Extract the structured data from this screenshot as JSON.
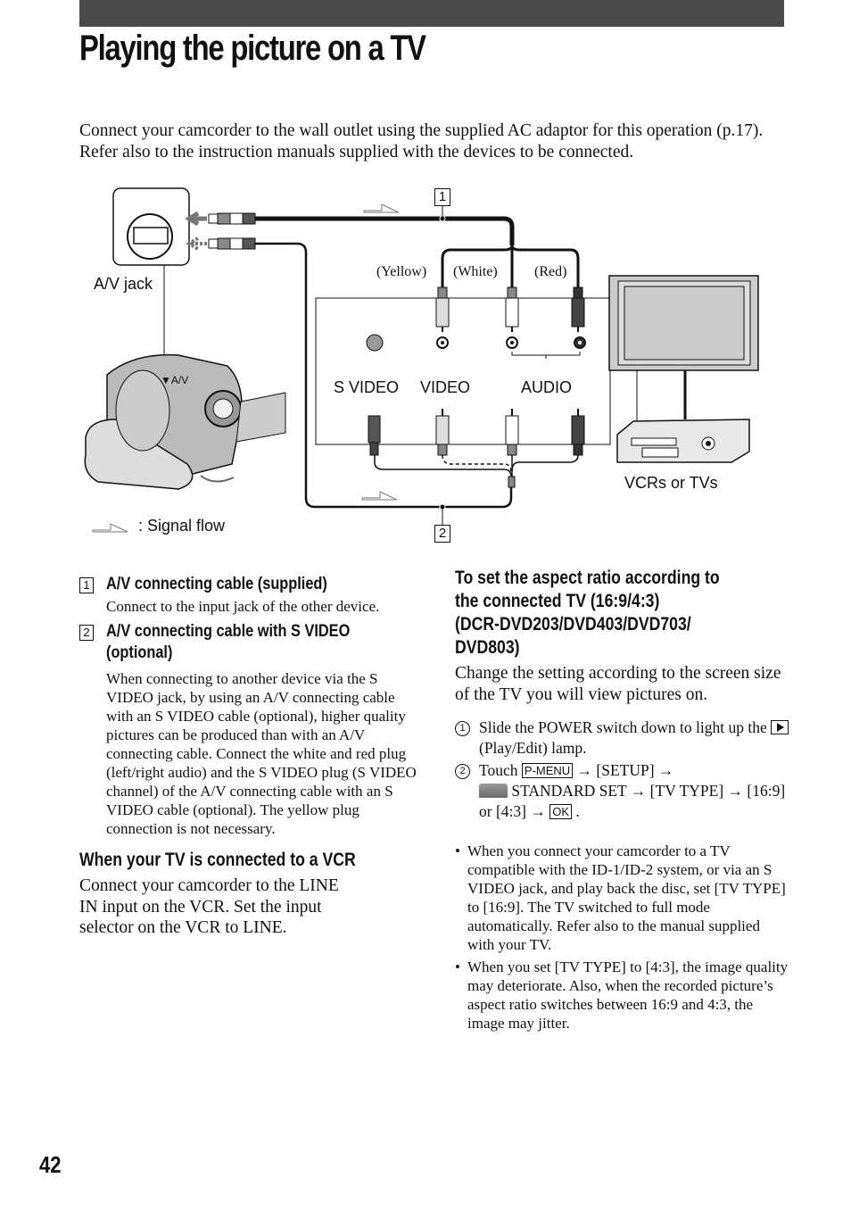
{
  "header": {
    "title": "Playing the picture on a TV",
    "intro": "Connect your camcorder to the wall outlet using the supplied AC adaptor for this operation (p.17). Refer also to the instruction manuals supplied with the devices to be connected."
  },
  "diagram": {
    "av_label": "▼A/V",
    "av_jack": "A/V jack",
    "yellow": "(Yellow)",
    "white": "(White)",
    "red": "(Red)",
    "s_video": "S VIDEO",
    "video": "VIDEO",
    "audio": "AUDIO",
    "vcrs": "VCRs or TVs",
    "signal_flow": ": Signal flow",
    "callout_1": "1",
    "callout_2": "2"
  },
  "items": [
    {
      "num": "1",
      "title": "A/V connecting cable (supplied)",
      "body": "Connect to the input jack of the other device."
    },
    {
      "num": "2",
      "title": "A/V connecting cable with S VIDEO",
      "title2": "(optional)",
      "body": "When connecting to another device via the S VIDEO jack, by using an A/V connecting cable with an S VIDEO cable (optional), higher quality pictures can be produced than with an A/V connecting cable. Connect the white and red plug (left/right audio) and the S VIDEO plug (S VIDEO channel) of the A/V connecting cable with an S VIDEO cable (optional). The yellow plug connection is not necessary."
    }
  ],
  "vcr_section": {
    "heading": "When your TV is connected to a VCR",
    "body_lines": [
      "Connect your camcorder to the LINE",
      "IN input on the VCR. Set the input",
      "selector on the VCR to LINE."
    ]
  },
  "aspect_section": {
    "heading_lines": [
      "To set the aspect ratio according to",
      "the connected TV (16:9/4:3)",
      "(DCR-DVD203/DVD403/DVD703/",
      "DVD803)"
    ],
    "intro": "Change the setting according to the screen size of the TV you will view pictures on.",
    "step1": {
      "num": "1",
      "a": "Slide the POWER switch down to light up the ",
      "b": " (Play/Edit) lamp."
    },
    "step2": {
      "num": "2",
      "a": "Touch ",
      "pmenu": "P-MENU",
      "b": " → [SETUP] → ",
      "c": " STANDARD SET → [TV TYPE] → [16:9] or [4:3] → ",
      "ok": "OK",
      "d": " ."
    },
    "notes": [
      "When you connect your camcorder to a TV compatible with the ID-1/ID-2 system, or via an S VIDEO jack, and play back the disc, set [TV TYPE] to [16:9]. The TV switched to full mode automatically. Refer also to the manual supplied with your TV.",
      "When you set [TV TYPE] to [4:3], the image quality may deteriorate. Also, when the recorded picture’s aspect ratio switches between 16:9 and 4:3, the image may jitter."
    ],
    "bullet": "•"
  },
  "footer": {
    "page_number": "42"
  }
}
